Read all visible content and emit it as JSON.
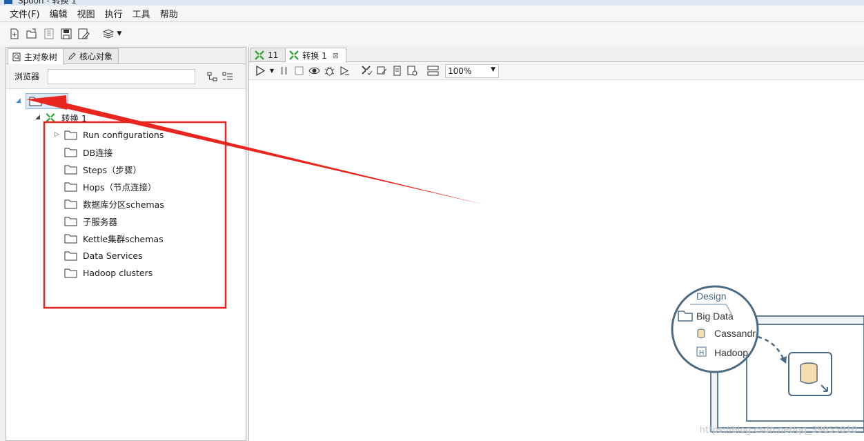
{
  "window": {
    "title": "Spoon - 转换 1"
  },
  "menu": {
    "items": [
      "文件(F)",
      "编辑",
      "视图",
      "执行",
      "工具",
      "帮助"
    ]
  },
  "left_panel": {
    "tabs": [
      {
        "label": "主对象树",
        "icon": "main-tree-icon"
      },
      {
        "label": "核心对象",
        "icon": "pencil-icon"
      }
    ],
    "browser_label": "浏览器",
    "search_value": "",
    "tree": {
      "root": "转换",
      "child": "转换 1",
      "folders": [
        "Run configurations",
        "DB连接",
        "Steps（步骤）",
        "Hops（节点连接）",
        "数据库分区schemas",
        "子服务器",
        "Kettle集群schemas",
        "Data Services",
        "Hadoop clusters"
      ]
    }
  },
  "right_panel": {
    "tabs": [
      {
        "label": "11"
      },
      {
        "label": "转换 1"
      }
    ],
    "zoom": "100%"
  },
  "promo": {
    "tab": "Design",
    "folder": "Big Data",
    "item1": "Cassandr",
    "item2": "Hadoop"
  },
  "watermark": "https://blog.csdn.net/qq_39055010",
  "colors": {
    "annotation_red": "#e8261f",
    "selection_bg": "#dce9f7",
    "kettle_green": "#3aa23a"
  }
}
